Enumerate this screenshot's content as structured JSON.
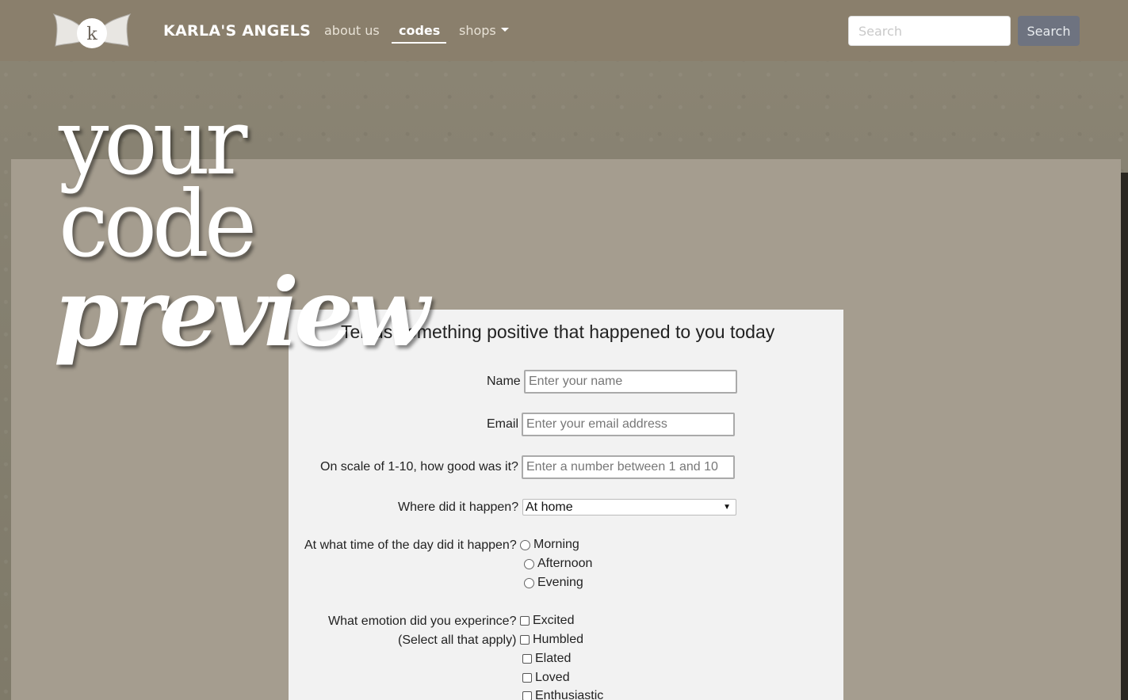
{
  "nav": {
    "brand": "KARLA'S ANGELS",
    "logo_letter": "k",
    "links": [
      {
        "label": "about us"
      },
      {
        "label": "codes"
      },
      {
        "label": "shops"
      }
    ],
    "search_placeholder": "Search",
    "search_button": "Search"
  },
  "hero": {
    "line1": "your",
    "line2": "code",
    "line3": "preview"
  },
  "form": {
    "title": "Tell us something positive that happened to you today",
    "name_label": "Name",
    "name_placeholder": "Enter your name",
    "email_label": "Email",
    "email_placeholder": "Enter your email address",
    "scale_label": "On scale of 1-10, how good was it?",
    "scale_placeholder": "Enter a number between 1 and 10",
    "where_label": "Where did it happen?",
    "where_value": "At home",
    "time_label": "At what time of the day did it happen?",
    "time_options": [
      "Morning",
      "Afternoon",
      "Evening"
    ],
    "emotion_label": "What emotion did you experince?",
    "emotion_sub": "(Select all that apply)",
    "emotion_options": [
      "Excited",
      "Humbled",
      "Elated",
      "Loved",
      "Enthusiastic"
    ]
  }
}
